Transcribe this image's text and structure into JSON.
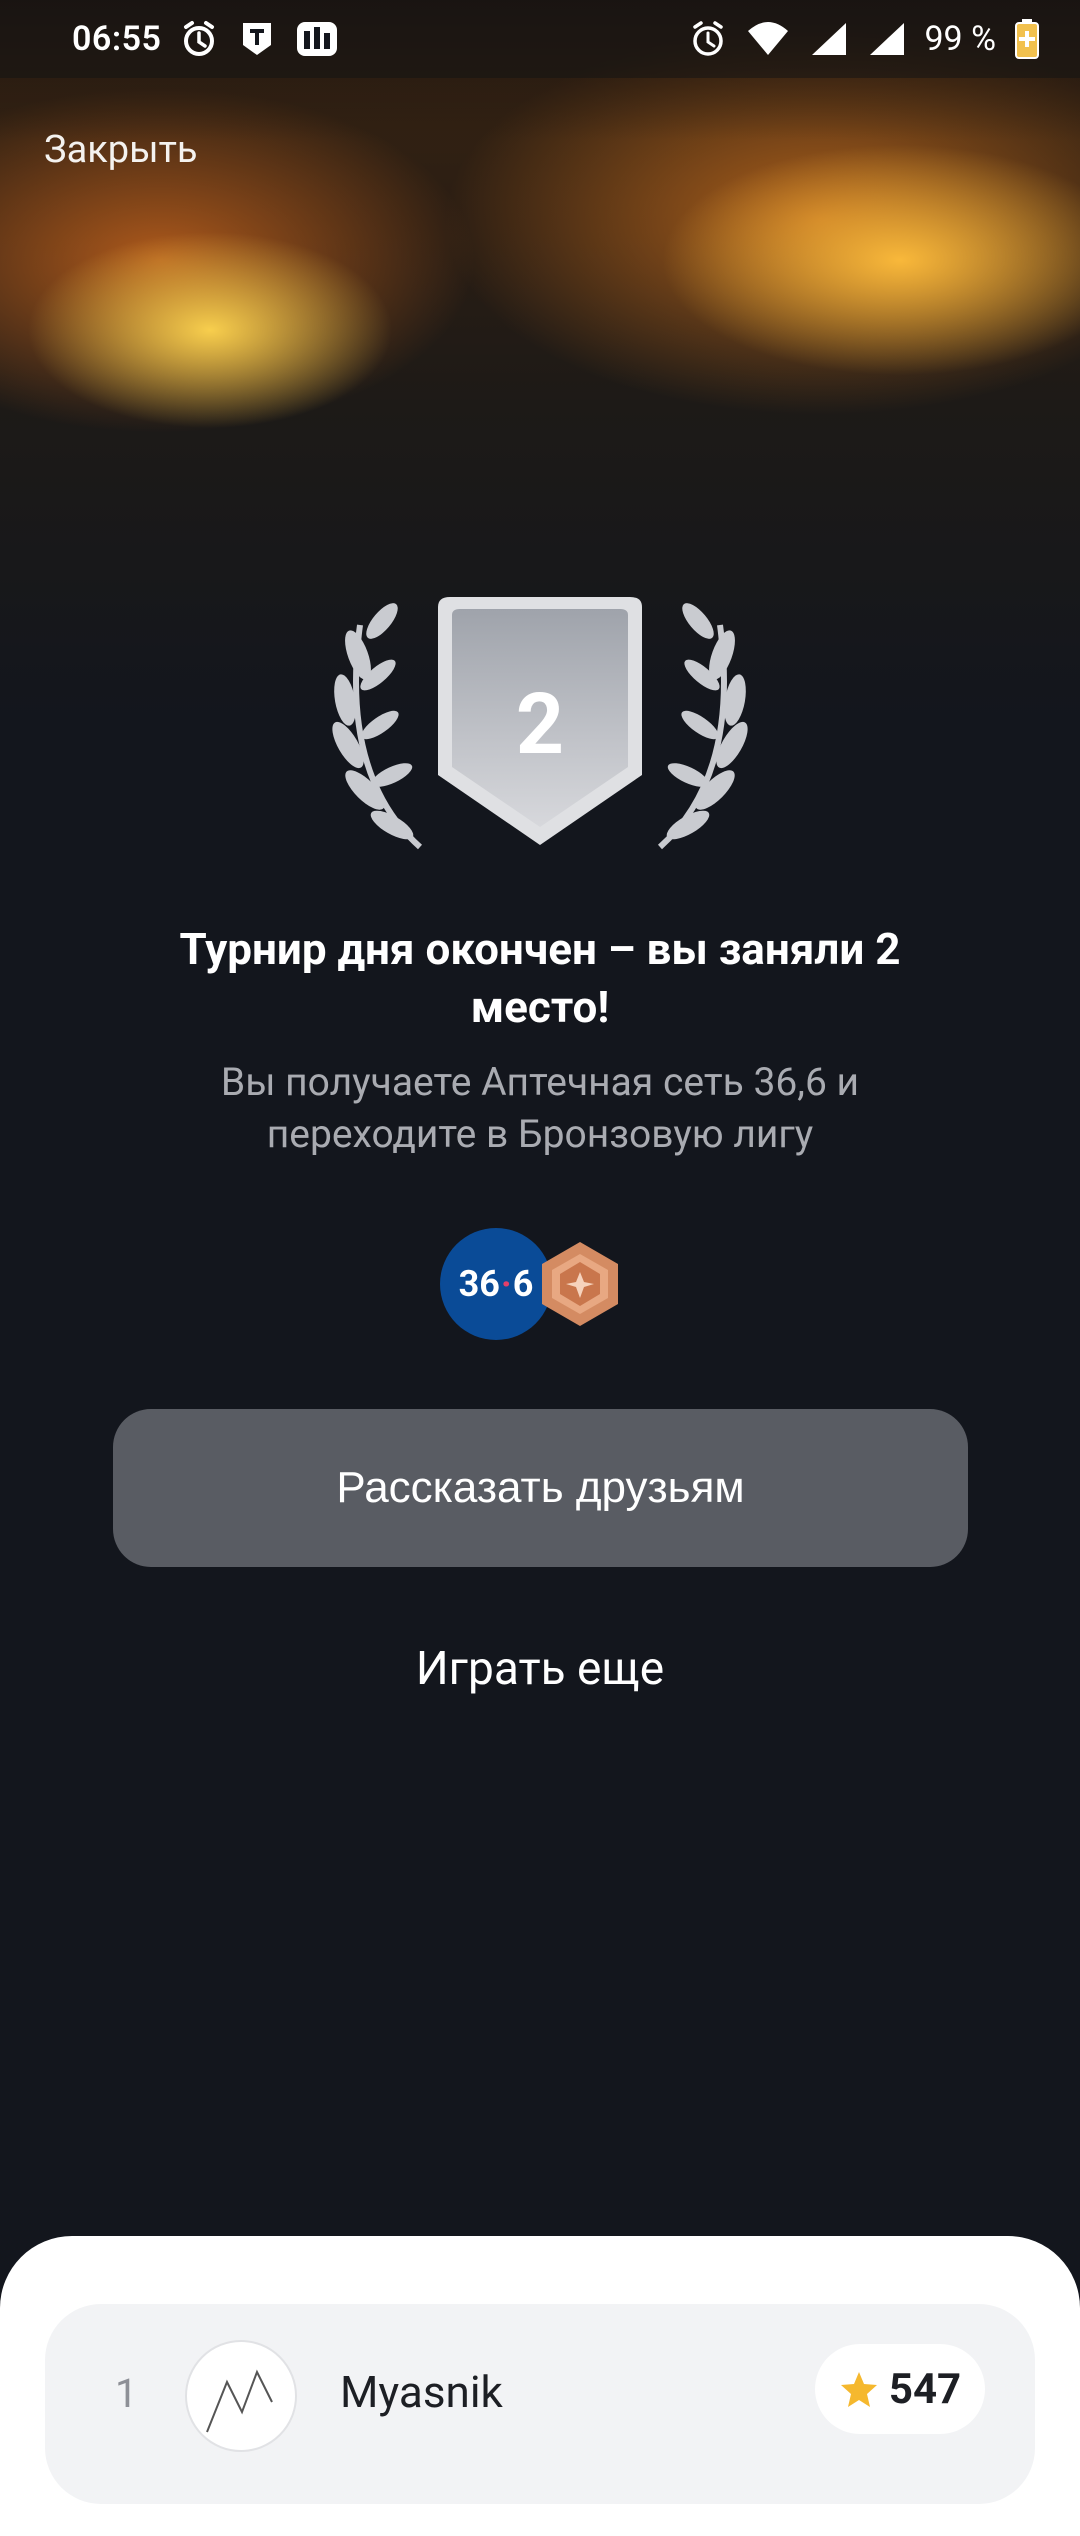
{
  "status_bar": {
    "time": "06:55",
    "battery": "99 %",
    "icons": [
      "alarm-icon",
      "t-app-icon",
      "wallet-app-icon",
      "alarm-icon",
      "wifi-icon",
      "signal-icon",
      "signal-icon",
      "battery-icon"
    ]
  },
  "header": {
    "close_label": "Закрыть"
  },
  "badge": {
    "place": "2",
    "medal": "silver-shield-icon",
    "wreath": "laurel-icon"
  },
  "result": {
    "title": "Турнир дня окончен – вы заняли 2 место!",
    "subtitle": "Вы получаете Аптечная сеть 36,6 и переходите в Бронзовую лигу"
  },
  "rewards": {
    "brand_logo_text_left": "36",
    "brand_logo_dot": "·",
    "brand_logo_text_right": "6",
    "league_icon": "bronze-league-icon"
  },
  "actions": {
    "share_label": "Рассказать друзьям",
    "play_again_label": "Играть еще"
  },
  "leaderboard": {
    "rows": [
      {
        "rank": "1",
        "name": "Myasnik",
        "score": "547"
      }
    ]
  },
  "colors": {
    "background": "#13161d",
    "share_button": "#595c63",
    "bronze": "#d48b62",
    "brand_blue": "#0a4b97"
  }
}
